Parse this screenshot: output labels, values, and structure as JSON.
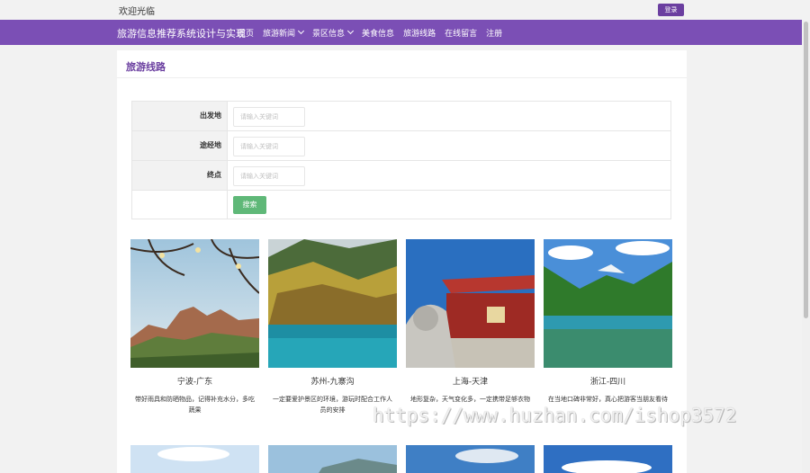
{
  "topbar": {
    "welcome": "欢迎光临",
    "login_label": "登录"
  },
  "navbar": {
    "brand": "旅游信息推荐系统设计与实现",
    "items": [
      {
        "label": "首页",
        "dropdown": false
      },
      {
        "label": "旅游新闻",
        "dropdown": true
      },
      {
        "label": "景区信息",
        "dropdown": true
      },
      {
        "label": "美食信息",
        "dropdown": false
      },
      {
        "label": "旅游线路",
        "dropdown": false
      },
      {
        "label": "在线留言",
        "dropdown": false
      },
      {
        "label": "注册",
        "dropdown": false
      }
    ],
    "color": "#7b4fb5"
  },
  "page": {
    "title": "旅游线路"
  },
  "search": {
    "fields": [
      {
        "label": "出发地",
        "placeholder": "请输入关键词",
        "value": ""
      },
      {
        "label": "途经地",
        "placeholder": "请输入关键词",
        "value": ""
      },
      {
        "label": "终点",
        "placeholder": "请输入关键词",
        "value": ""
      }
    ],
    "button_label": "搜索",
    "button_color": "#5fb878"
  },
  "routes": [
    {
      "name": "宁波-广东",
      "desc": "带好雨具和防晒物品，记得补充水分，多吃蔬果"
    },
    {
      "name": "苏州-九寨沟",
      "desc": "一定要爱护景区的环境，游玩时配合工作人员的安排"
    },
    {
      "name": "上海-天津",
      "desc": "地形复杂，天气变化多，一定携带足够衣物"
    },
    {
      "name": "浙江-四川",
      "desc": "在当地口碑非常好，真心把游客当朋友看待"
    }
  ],
  "watermark": "https://www.huzhan.com/ishop3572"
}
